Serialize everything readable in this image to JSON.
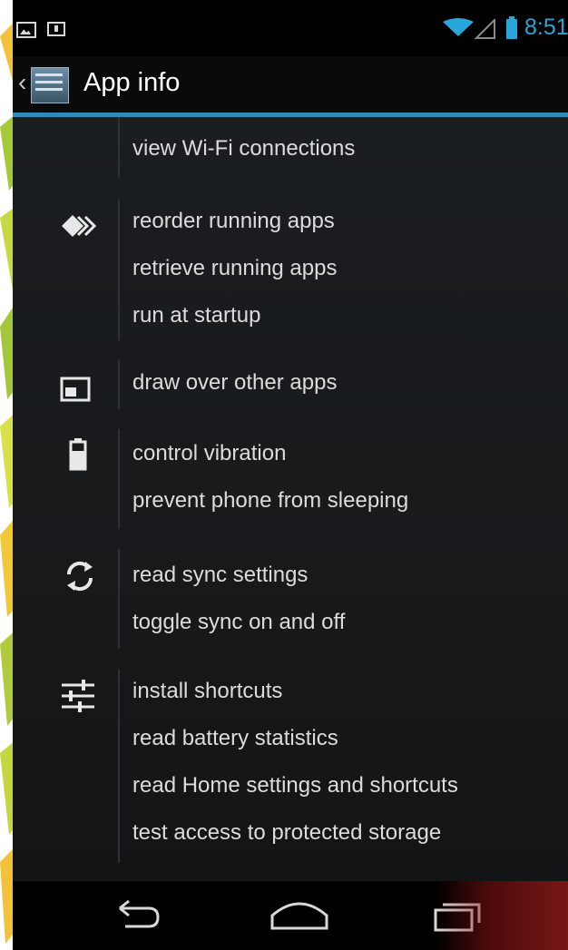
{
  "status_bar": {
    "time": "8:51",
    "icons": [
      "gallery-icon",
      "message-icon",
      "wifi-icon",
      "signal-icon",
      "battery-icon"
    ]
  },
  "action_bar": {
    "title": "App info",
    "up_icon": "back-caret-icon"
  },
  "permission_groups": [
    {
      "icon": null,
      "items": [
        "view Wi-Fi connections"
      ]
    },
    {
      "icon": "apps-icon",
      "items": [
        "reorder running apps",
        "retrieve running apps",
        "run at startup"
      ]
    },
    {
      "icon": "window-overlay-icon",
      "items": [
        "draw over other apps"
      ]
    },
    {
      "icon": "battery-icon",
      "items": [
        "control vibration",
        "prevent phone from sleeping"
      ]
    },
    {
      "icon": "sync-icon",
      "items": [
        "read sync settings",
        "toggle sync on and off"
      ]
    },
    {
      "icon": "sliders-icon",
      "items": [
        "install shortcuts",
        "read battery statistics",
        "read Home settings and shortcuts",
        "test access to protected storage"
      ]
    }
  ],
  "nav_bar": {
    "buttons": [
      "back-icon",
      "home-icon",
      "recent-apps-icon"
    ]
  },
  "colors": {
    "accent": "#2f8bb4",
    "status_blue": "#2aa4d6",
    "text": "#dcdcdc",
    "background": "#1c1f22"
  }
}
